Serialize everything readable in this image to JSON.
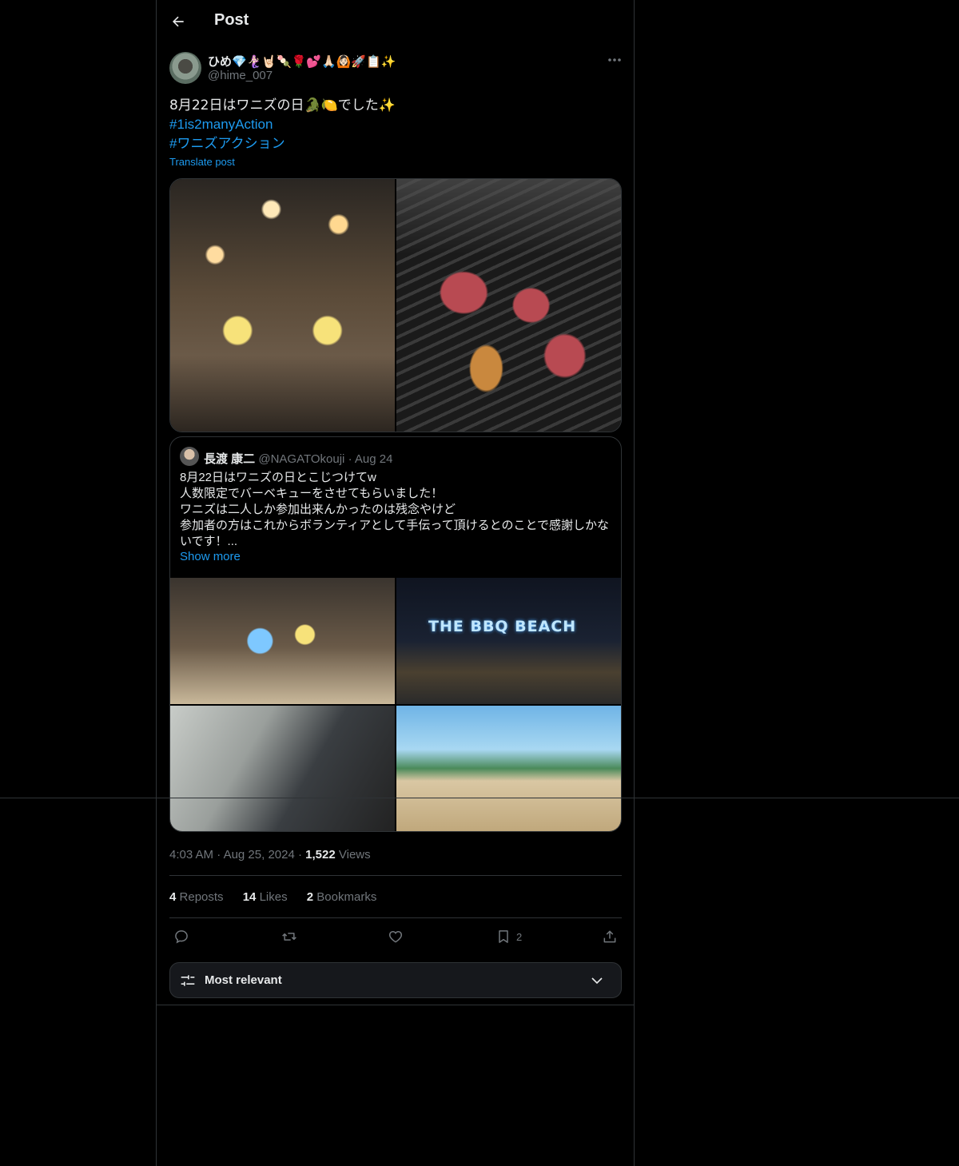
{
  "header": {
    "title": "Post"
  },
  "post": {
    "author": {
      "display_name": "ひめ💎🧜🏻‍♀️🤘🏻🍡🌹💕🙏🏻🙆🏻🚀📋✨",
      "handle": "@hime_007"
    },
    "text_line1": "8月22日はワニズの日🐊🍋でした✨",
    "hashtags": [
      "#1is2manyAction",
      "#ワニズアクション"
    ],
    "translate_label": "Translate post",
    "quoted": {
      "name": "長渡 康二",
      "handle": "@NAGATOkouji",
      "date": "Aug 24",
      "lines": [
        "8月22日はワニズの日とこじつけてw",
        "人数限定でバーベキューをさせてもらいました！",
        "ワニズは二人しか参加出来んかったのは残念やけど",
        "参加者の方はこれからボランティアとして手伝って頂けるとのことで感謝しかな",
        "いです！..."
      ],
      "show_more": "Show more",
      "sign_text": "THE BBQ  BEACH"
    },
    "time": "4:03 AM",
    "date": "Aug 25, 2024",
    "views_count": "1,522",
    "views_label": "Views",
    "stats": {
      "reposts_count": "4",
      "reposts_label": "Reposts",
      "likes_count": "14",
      "likes_label": "Likes",
      "bookmarks_count": "2",
      "bookmarks_label": "Bookmarks"
    },
    "actions": {
      "bookmark_count": "2"
    },
    "sort": {
      "label": "Most relevant"
    }
  },
  "colors": {
    "accent": "#1d9bf0",
    "muted": "#71767b",
    "text": "#e7e9ea",
    "border": "#2f3336",
    "background": "#000000"
  }
}
